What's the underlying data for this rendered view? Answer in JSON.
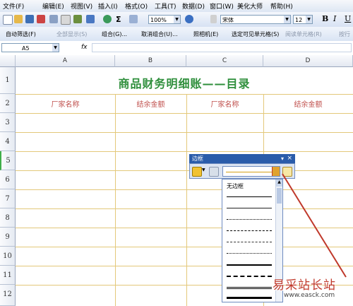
{
  "menu": [
    "文件(F)",
    "编辑(E)",
    "视图(V)",
    "插入(I)",
    "格式(O)",
    "工具(T)",
    "数据(D)",
    "窗口(W)",
    "美化大师",
    "帮助(H)"
  ],
  "toolbar1": {
    "zoom": "100%",
    "font_name": "宋体",
    "font_size": "12",
    "sigma": "Σ",
    "bold": "B",
    "italic": "I",
    "underline": "U"
  },
  "toolbar2": {
    "items": [
      "自动筛选(F)",
      "全部显示(S)",
      "组合(G)...",
      "取消组合(U)...",
      "照相机(E)",
      "选定可见单元格(S)",
      "阅读单元格(R)",
      "按行"
    ]
  },
  "formula_bar": {
    "name_box": "A5",
    "fx": "fx"
  },
  "columns": [
    "A",
    "B",
    "C",
    "D"
  ],
  "rows": [
    "1",
    "2",
    "3",
    "4",
    "5",
    "6",
    "7",
    "8",
    "9",
    "10",
    "11",
    "12"
  ],
  "sheet": {
    "title": "商品财务明细账——目录",
    "headers": [
      "厂家名称",
      "结余金额",
      "厂家名称",
      "结余金额"
    ]
  },
  "border_panel": {
    "title": "边框",
    "close": "×",
    "dropdown_arrow": "▾",
    "no_border": "无边框"
  },
  "watermark": {
    "line1": "易采站长站",
    "line2": "www.easck.com"
  },
  "colors": {
    "title_green": "#2f8f3c",
    "header_red": "#c0504d",
    "gridline_gold": "#e3c87a",
    "arrow_red": "#c0392b",
    "panel_blue": "#2a5caa"
  }
}
